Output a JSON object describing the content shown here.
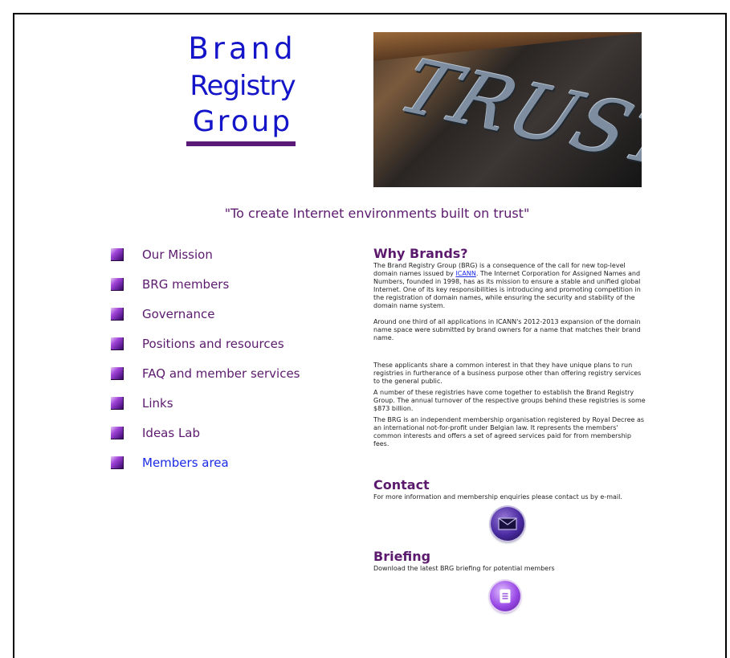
{
  "logo": {
    "line1": "Brand",
    "line2": "Registry",
    "line3": "Group"
  },
  "hero": {
    "word": "TRUST"
  },
  "tagline": "\"To create Internet environments built on trust\"",
  "nav": {
    "items": [
      {
        "label": "Our Mission"
      },
      {
        "label": "BRG members"
      },
      {
        "label": "Governance"
      },
      {
        "label": "Positions and resources"
      },
      {
        "label": "FAQ and member services"
      },
      {
        "label": "Links"
      },
      {
        "label": "Ideas Lab"
      },
      {
        "label": "Members area"
      }
    ]
  },
  "why": {
    "heading": "Why Brands?",
    "p1_before": "The Brand Registry Group (BRG) is a consequence of the call for new top-level domain names issued by ",
    "p1_link": "ICANN",
    "p1_after": ".  The Internet Corporation for Assigned Names and Numbers, founded in 1998, has as its mission to ensure a stable and unified global Internet. One of its key responsibilities is introducing and promoting competition in the registration of domain names, while ensuring the security and stability of the domain name system.",
    "p2": "Around one third of all applications in ICANN's 2012-2013 expansion of the domain name space were submitted by brand owners for a name that matches their brand name.",
    "p3": "These applicants share a common interest in that they have unique plans to run registries in furtherance of a business purpose other than offering registry services to the general public.",
    "p4": "A number of these registries have come together to establish the Brand Registry Group. The annual turnover of the respective groups behind these registries is some $873 billion.",
    "p5": "The BRG is an independent membership organisation registered by Royal Decree as an international not-for-profit under Belgian law. It represents the members' common interests and offers a set of agreed services paid for from membership fees."
  },
  "contact": {
    "heading": "Contact",
    "text": "For more information and membership enquiries please contact us by e-mail."
  },
  "briefing": {
    "heading": "Briefing",
    "text": "Download the latest BRG briefing for potential members"
  },
  "colors": {
    "brand_blue": "#1414c8",
    "purple_text": "#5c1a6e",
    "link_blue": "#1a2ae6"
  },
  "icons": {
    "nav_bullet": "purple-square-bullet-icon",
    "contact": "envelope-icon",
    "briefing": "document-icon"
  }
}
